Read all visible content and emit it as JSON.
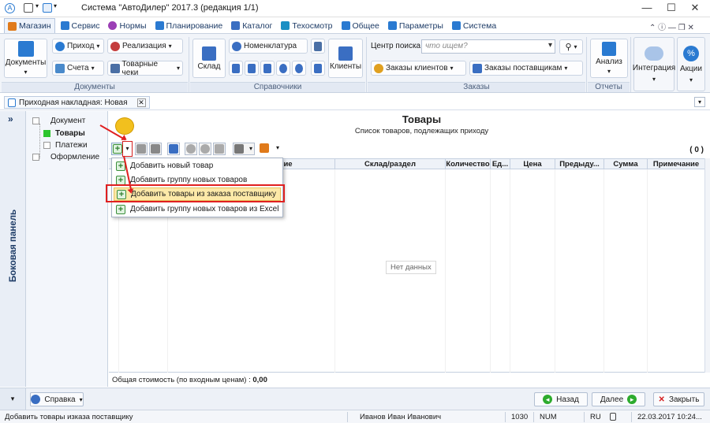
{
  "window": {
    "title": "Система \"АвтоДилер\" 2017.3 (редакция 1/1)"
  },
  "tabs": [
    {
      "label": "Магазин",
      "color": "#e07a1a"
    },
    {
      "label": "Сервис",
      "color": "#2a7ad1"
    },
    {
      "label": "Нормы",
      "color": "#9b3fb5"
    },
    {
      "label": "Планирование",
      "color": "#2a7ad1"
    },
    {
      "label": "Каталог",
      "color": "#3a6ec2"
    },
    {
      "label": "Техосмотр",
      "color": "#1a8fc4"
    },
    {
      "label": "Общее",
      "color": "#2a7ad1"
    },
    {
      "label": "Параметры",
      "color": "#2a7ad1"
    },
    {
      "label": "Система",
      "color": "#2a7ad1"
    }
  ],
  "ribbon": {
    "documents": {
      "main": "Документы",
      "b1": "Приход",
      "b2": "Счета",
      "b3": "Реализация",
      "b4": "Товарные чеки",
      "group": "Документы"
    },
    "refs": {
      "sklad": "Склад",
      "nomenklatura": "Номенклатура",
      "clients": "Клиенты",
      "group": "Справочники"
    },
    "search": {
      "label": "Центр поиска :",
      "placeholder": "что ищем?"
    },
    "orders": {
      "b1": "Заказы клиентов",
      "b2": "Заказы поставщикам",
      "group": "Заказы"
    },
    "reports": {
      "b1": "Анализ",
      "group": "Отчеты"
    },
    "integration": "Интеграция",
    "actions": "Акции"
  },
  "doc_tab": {
    "label": "Приходная накладная: Новая"
  },
  "side_panel": {
    "label": "Боковая панель",
    "toggle": "»"
  },
  "nav": [
    {
      "label": "Документ"
    },
    {
      "label": "Товары"
    },
    {
      "label": "Платежи"
    },
    {
      "label": "Оформление"
    }
  ],
  "main": {
    "title": "Товары",
    "subtitle": "Список товаров, подлежащих приходу",
    "count": "( 0 )"
  },
  "grid": {
    "columns": [
      "Склад/раздел",
      "Количество",
      "Ед...",
      "Цена",
      "Предыду...",
      "Сумма",
      "Примечание"
    ],
    "partial_header": "ие",
    "empty": "Нет данных",
    "total_label": "Общая стоимость (по входным ценам) :",
    "total_value": "0,00"
  },
  "menu": [
    "Добавить новый товар",
    "Добавить группу новых товаров",
    "Добавить товары из заказа поставщику",
    "Добавить группу новых товаров из Excel"
  ],
  "bottom": {
    "help": "Справка",
    "back": "Назад",
    "next": "Далее",
    "close": "Закрыть"
  },
  "status": {
    "hint": "Добавить товары изказа поставщику",
    "user": "Иванов Иван Иванович",
    "num": "1030",
    "numlock": "NUM",
    "lang": "RU",
    "datetime": "22.03.2017 10:24..."
  }
}
